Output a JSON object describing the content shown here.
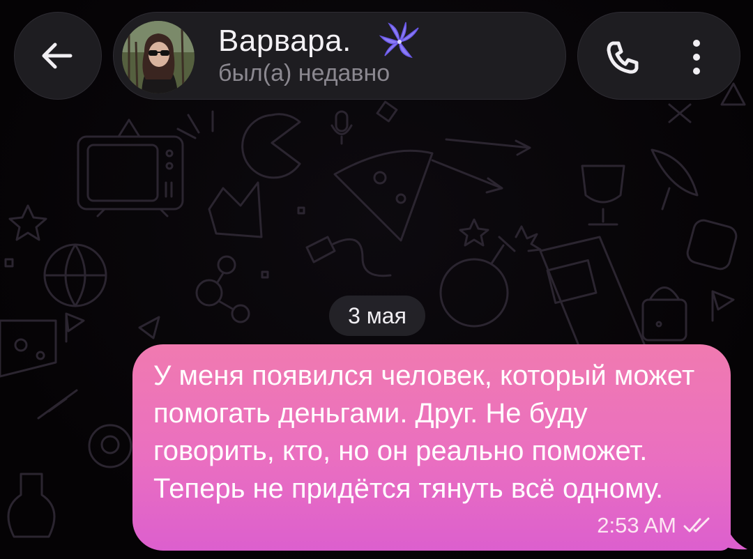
{
  "header": {
    "contact_name": "Варвара.",
    "contact_status": "был(а) недавно"
  },
  "icons": {
    "back": "arrow-left-icon",
    "avatar": "profile-photo",
    "decoration": "lily-flower-icon",
    "call": "phone-icon",
    "more": "vertical-dots-icon",
    "read_status": "double-check-icon"
  },
  "chat": {
    "date_separator": "3 мая",
    "messages": [
      {
        "direction": "outgoing",
        "text": "У меня появился человек, который может помогать деньгами. Друг. Не буду говорить, кто, но он реально поможет. Теперь не придётся тянуть всё одному.",
        "time": "2:53 AM",
        "status": "read"
      }
    ]
  },
  "colors": {
    "background": "#060407",
    "pattern": "#2b2530",
    "header_surface": "#1e1d21",
    "bubble_top": "#f07ab0",
    "bubble_bottom": "#dc5fce",
    "accent_lily": "#8c7df5"
  }
}
